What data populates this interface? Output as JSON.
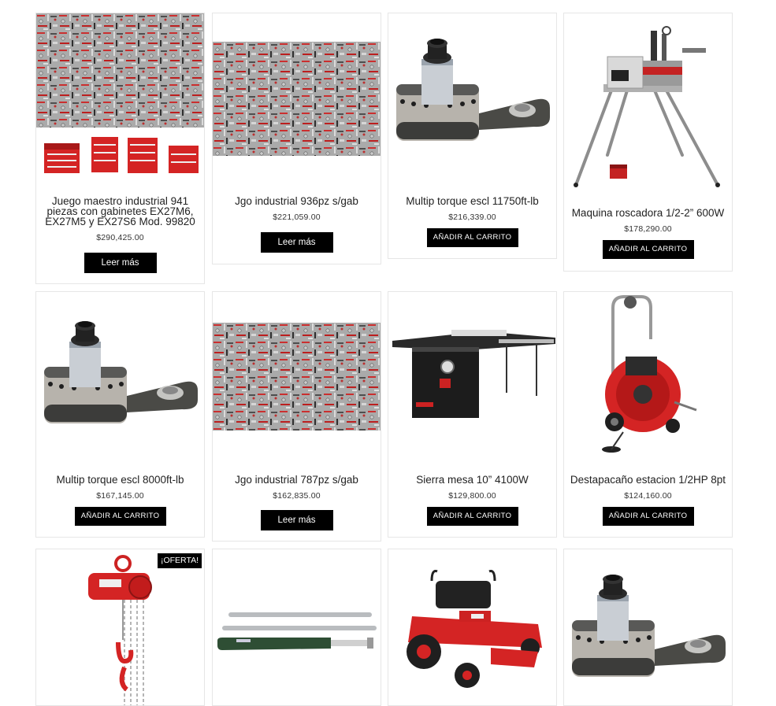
{
  "products": [
    {
      "title": "Juego maestro industrial 941 piezas con gabinetes EX27M6, EX27M5 y EX27S6 Mod. 99820",
      "price": "$290,425.00",
      "button": "Leer más"
    },
    {
      "title": "Jgo industrial 936pz s/gab",
      "price": "$221,059.00",
      "button": "Leer más"
    },
    {
      "title": "Multip torque escl 11750ft-lb",
      "price": "$216,339.00",
      "button": "AÑADIR AL CARRITO"
    },
    {
      "title": "Maquina roscadora 1/2-2” 600W",
      "price": "$178,290.00",
      "button": "AÑADIR AL CARRITO"
    },
    {
      "title": "Multip torque escl 8000ft-lb",
      "price": "$167,145.00",
      "button": "AÑADIR AL CARRITO"
    },
    {
      "title": "Jgo industrial 787pz s/gab",
      "price": "$162,835.00",
      "button": "Leer más"
    },
    {
      "title": "Sierra mesa 10” 4100W",
      "price": "$129,800.00",
      "button": "AÑADIR AL CARRITO"
    },
    {
      "title": "Destapacaño estacion 1/2HP 8pt",
      "price": "$124,160.00",
      "button": "AÑADIR AL CARRITO"
    }
  ],
  "badges": {
    "sale": "¡OFERTA!"
  }
}
